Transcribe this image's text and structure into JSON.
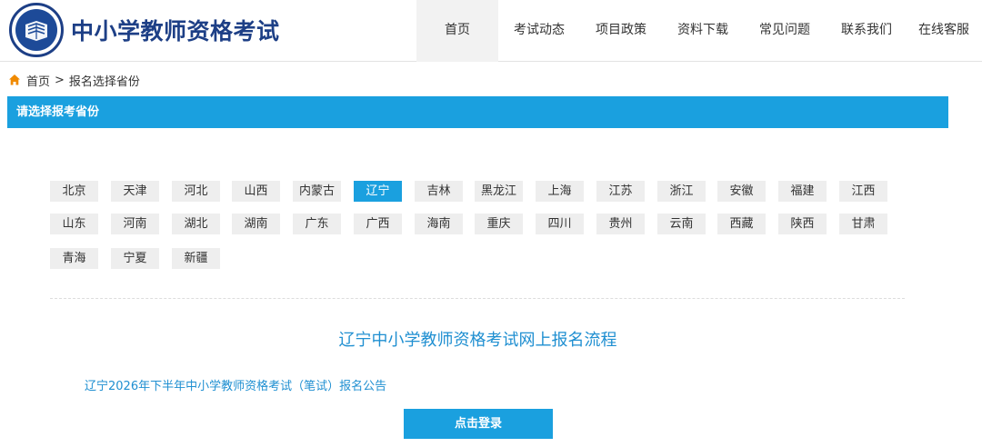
{
  "header": {
    "site_title": "中小学教师资格考试",
    "logo_icon": "school-emblem-icon",
    "nav": [
      {
        "label": "首页",
        "active": true
      },
      {
        "label": "考试动态",
        "active": false
      },
      {
        "label": "项目政策",
        "active": false
      },
      {
        "label": "资料下载",
        "active": false
      },
      {
        "label": "常见问题",
        "active": false
      },
      {
        "label": "联系我们",
        "active": false
      },
      {
        "label": "在线客服",
        "active": false
      }
    ]
  },
  "breadcrumb": {
    "home_icon": "home-icon",
    "home_label": "首页",
    "separator": ">",
    "current": "报名选择省份"
  },
  "section": {
    "title": "请选择报考省份"
  },
  "provinces": [
    {
      "label": "北京",
      "active": false
    },
    {
      "label": "天津",
      "active": false
    },
    {
      "label": "河北",
      "active": false
    },
    {
      "label": "山西",
      "active": false
    },
    {
      "label": "内蒙古",
      "active": false
    },
    {
      "label": "辽宁",
      "active": true
    },
    {
      "label": "吉林",
      "active": false
    },
    {
      "label": "黑龙江",
      "active": false
    },
    {
      "label": "上海",
      "active": false
    },
    {
      "label": "江苏",
      "active": false
    },
    {
      "label": "浙江",
      "active": false
    },
    {
      "label": "安徽",
      "active": false
    },
    {
      "label": "福建",
      "active": false
    },
    {
      "label": "江西",
      "active": false
    },
    {
      "label": "山东",
      "active": false
    },
    {
      "label": "河南",
      "active": false
    },
    {
      "label": "湖北",
      "active": false
    },
    {
      "label": "湖南",
      "active": false
    },
    {
      "label": "广东",
      "active": false
    },
    {
      "label": "广西",
      "active": false
    },
    {
      "label": "海南",
      "active": false
    },
    {
      "label": "重庆",
      "active": false
    },
    {
      "label": "四川",
      "active": false
    },
    {
      "label": "贵州",
      "active": false
    },
    {
      "label": "云南",
      "active": false
    },
    {
      "label": "西藏",
      "active": false
    },
    {
      "label": "陕西",
      "active": false
    },
    {
      "label": "甘肃",
      "active": false
    },
    {
      "label": "青海",
      "active": false
    },
    {
      "label": "宁夏",
      "active": false
    },
    {
      "label": "新疆",
      "active": false
    }
  ],
  "main": {
    "flow_title": "辽宁中小学教师资格考试网上报名流程",
    "notice_link": "辽宁2026年下半年中小学教师资格考试（笔试）报名公告",
    "login_button": "点击登录"
  },
  "colors": {
    "primary": "#1aa0df",
    "brand_dark": "#1d3f86",
    "link": "#1f8fd1",
    "home_icon": "#f08a00"
  }
}
